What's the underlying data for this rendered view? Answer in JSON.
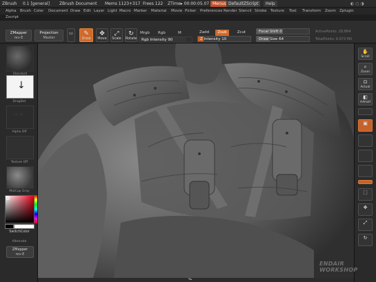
{
  "titlebar": {
    "app": "ZBrush",
    "doc_tag": "0.1 [general]",
    "document": "ZBrush Document",
    "mem": "Mems 1123+317",
    "free": "Frees 122",
    "ztime": "ZTime▸ 00:00:05.07",
    "menus_btn": "Menus",
    "script_btn": "DefaultZScript",
    "help_btn": "Help"
  },
  "menubar": {
    "items": [
      "Alpha",
      "Brush",
      "Color",
      "Document",
      "Draw",
      "Edit",
      "Layer",
      "Light",
      "Macro",
      "Marker",
      "Material",
      "Movie",
      "Picker",
      "Preferences",
      "Render",
      "Stencil",
      "Stroke",
      "Texture",
      "Tool",
      "Transform",
      "Zoom",
      "Zplugin"
    ],
    "zscript": "Zscript"
  },
  "toolbar": {
    "zmapper_top": "ZMapper",
    "zmapper_top_sub": "rev-E",
    "projection": "Projection",
    "projection_sub": "Master",
    "draw": "Draw",
    "move": "Move",
    "scale": "Scale",
    "rotate": "Rotate",
    "mrgb": "Mrgb",
    "rgb": "Rgb",
    "m": "M",
    "rgb_intensity": "Rgb Intensity 90",
    "zadd": "Zadd",
    "zsub": "Zsub",
    "zcut": "Zcut",
    "z_intensity": "Z Intensity 10",
    "focal_shift": "Focal Shift 0",
    "draw_size": "Draw Size 64",
    "active_points": "ActivePoints: 28,864",
    "total_points": "TotalPoints: 6.673 Mil"
  },
  "leftshelf": {
    "brush_label": "Standard",
    "stroke_label": "DragDot",
    "alpha_label": "Alpha Off",
    "texture_label": "Texture Off",
    "material_label": "MatCap Gray",
    "switch_color": "SwitchColor",
    "alternate": "Alternate",
    "zmapper_bottom": "ZMapper",
    "zmapper_bottom_sub": "rev-E"
  },
  "rightshelf": {
    "scroll": "Scroll",
    "zoom": "Zoom",
    "actual": "Actual",
    "aahalf": "AAHalf"
  },
  "watermark": {
    "line1": "ENDAIR",
    "line2": "WORKSHOP"
  },
  "colors": {
    "accent": "#d06a2a",
    "bg": "#2a2a2a",
    "canvas": "#4a4a4a"
  }
}
